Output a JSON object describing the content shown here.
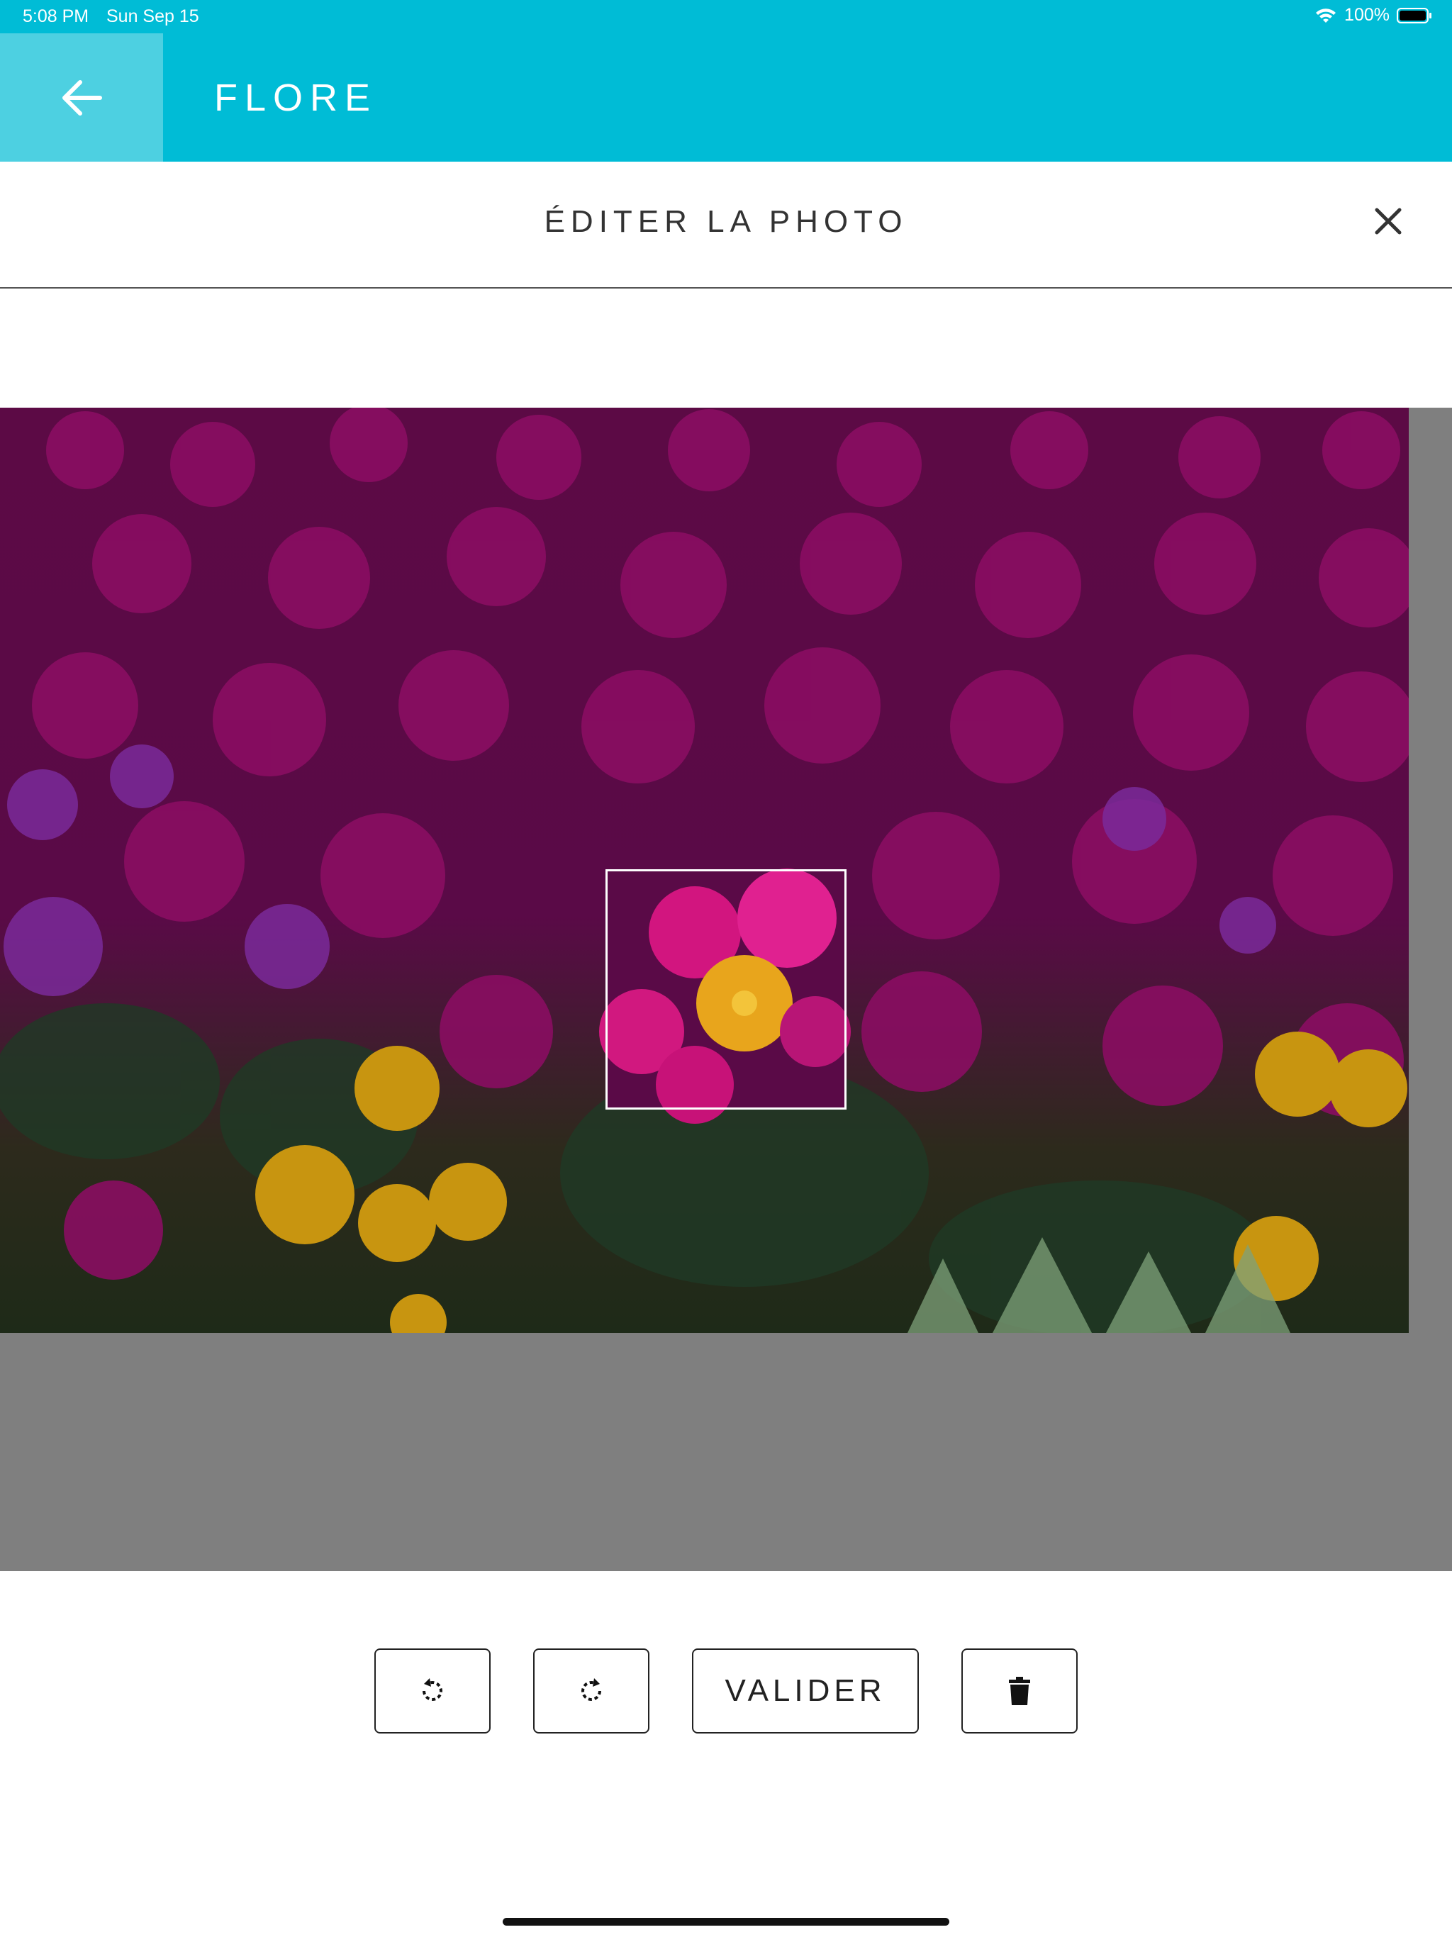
{
  "status_bar": {
    "time": "5:08 PM",
    "date": "Sun Sep 15",
    "battery": "100%",
    "icons": [
      "wifi-icon",
      "battery-icon"
    ]
  },
  "app_bar": {
    "title": "FLORE",
    "back_icon": "arrow-left-icon",
    "color": "#00bcd6",
    "back_bg_color": "#4dd0e1"
  },
  "dialog": {
    "title": "ÉDITER LA PHOTO",
    "close_icon": "close-icon"
  },
  "editor": {
    "image_description": "field of magenta and yellow ice plant flowers",
    "crop_selection": true
  },
  "toolbar": {
    "rotate_left_icon": "rotate-left-icon",
    "rotate_right_icon": "rotate-right-icon",
    "validate_label": "VALIDER",
    "delete_icon": "trash-icon"
  }
}
